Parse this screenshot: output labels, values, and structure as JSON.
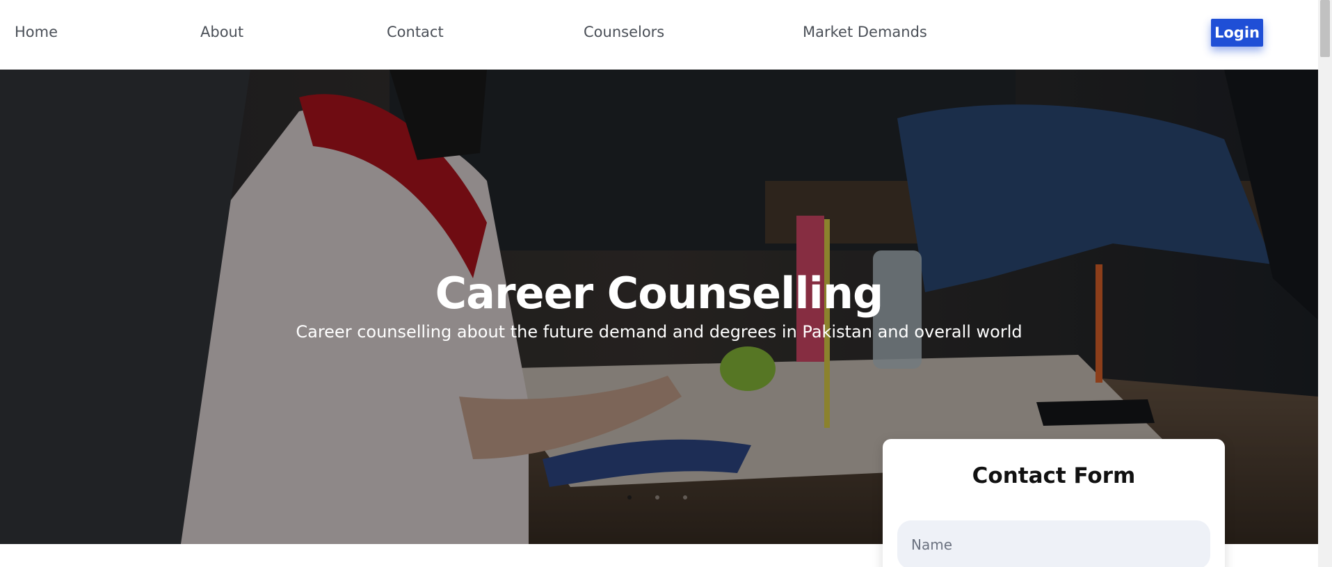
{
  "nav": {
    "items": [
      {
        "label": "Home"
      },
      {
        "label": "About"
      },
      {
        "label": "Contact"
      },
      {
        "label": "Counselors"
      },
      {
        "label": "Market Demands"
      }
    ],
    "login_label": "Login"
  },
  "hero": {
    "title": "Career Counselling",
    "subtitle": "Career counselling about the future demand and degrees in Pakistan and overall world",
    "carousel": {
      "slides": 3,
      "active_index": 0
    }
  },
  "contact_form": {
    "title": "Contact Form",
    "name_placeholder": "Name"
  },
  "colors": {
    "login_button": "#1f4fd6",
    "nav_text": "#4a4f57",
    "input_bg": "#eef1f7"
  }
}
